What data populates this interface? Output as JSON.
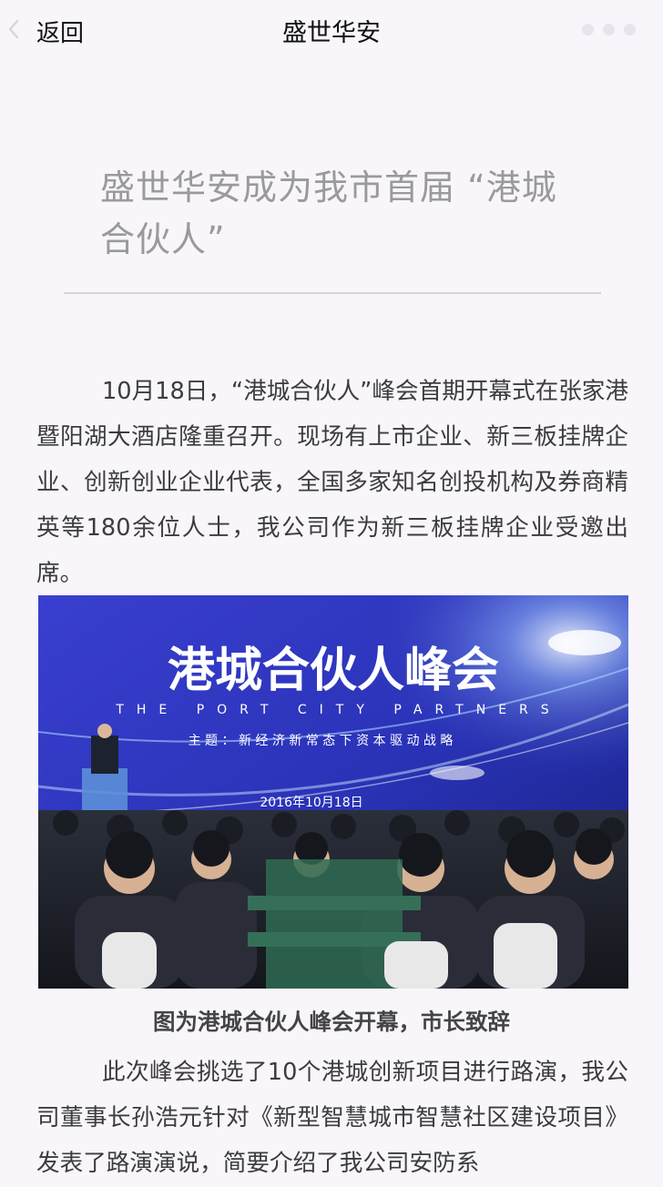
{
  "nav": {
    "back_label": "返回",
    "title": "盛世华安"
  },
  "article": {
    "title": "盛世华安成为我市首届 “港城合伙人”",
    "paragraph_1": "10月18日，“港城合伙人”峰会首期开幕式在张家港暨阳湖大酒店隆重召开。现场有上市企业、新三板挂牌企业、创新创业企业代表，全国多家知名创投机构及券商精英等180余位人士，我公司作为新三板挂牌企业受邀出席。",
    "photo": {
      "banner_title": "港城合伙人峰会",
      "banner_subtitle": "THE PORT CITY PARTNERS",
      "banner_theme": "主 题 ： 新 经 济 新 常 态 下 资 本 驱 动 战 略",
      "banner_date": "2016年10月18日"
    },
    "caption": "图为港城合伙人峰会开幕，市长致辞",
    "paragraph_2": "此次峰会挑选了10个港城创新项目进行路演，我公司董事长孙浩元针对《新型智慧城市智慧社区建设项目》发表了路演演说，简要介绍了我公司安防系"
  },
  "colors": {
    "page_bg": "#f9f6fb",
    "title_gray": "#9a9a9a",
    "body_text": "#3c3c3c",
    "stage_blue": "#2a33b8"
  }
}
